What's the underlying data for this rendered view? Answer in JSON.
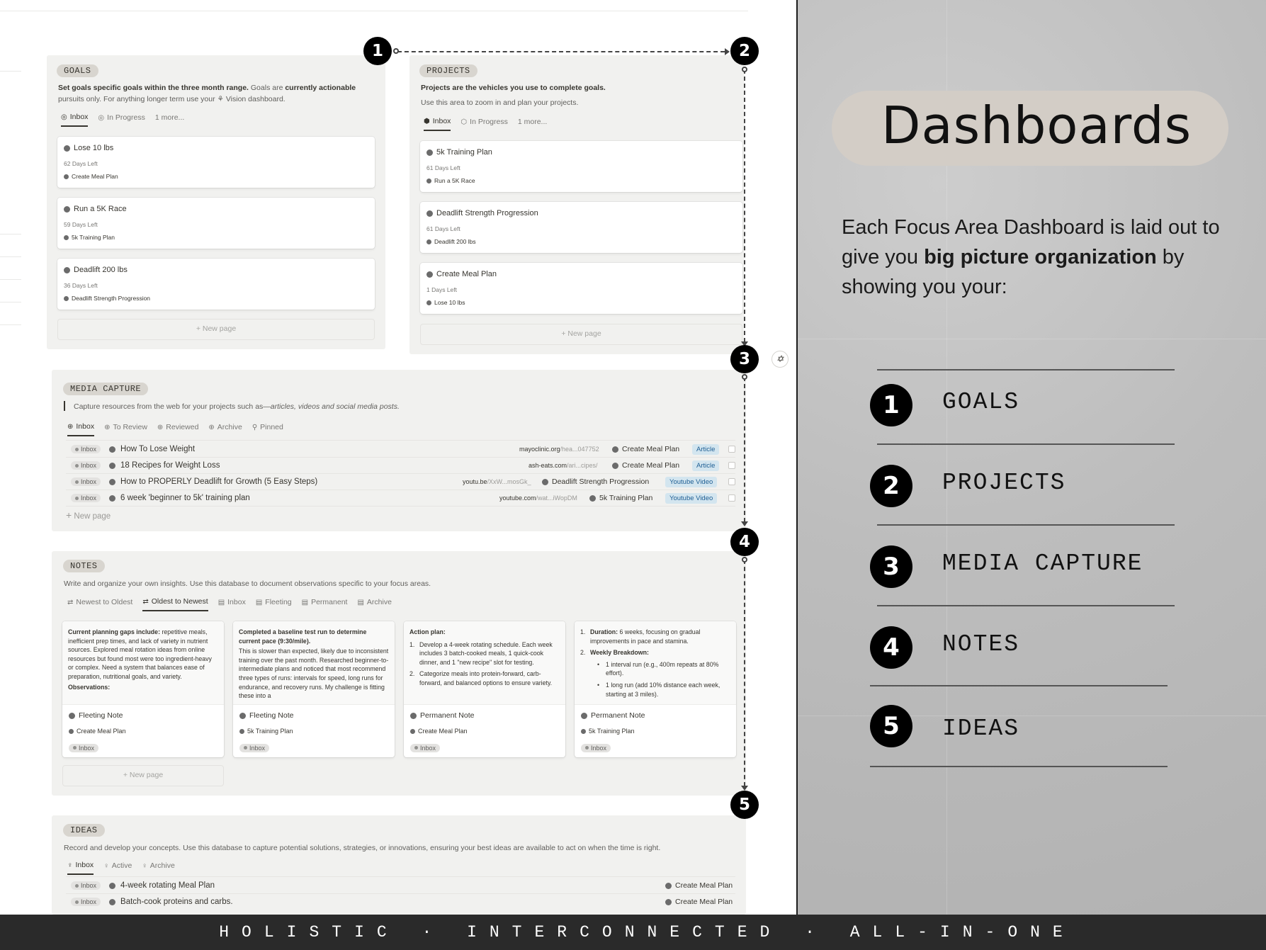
{
  "goals": {
    "tag": "GOALS",
    "desc_bold1": "Set goals specific goals within the three month range.",
    "desc_mid": " Goals are ",
    "desc_bold2": "currently actionable",
    "desc_line2": "pursuits only. For anything longer term use your",
    "desc_link": "Vision",
    "desc_end": " dashboard.",
    "tabs": [
      {
        "label": "Inbox"
      },
      {
        "label": "In Progress"
      },
      {
        "label": "1 more..."
      }
    ],
    "cards": [
      {
        "title": "Lose 10 lbs",
        "days": "62 Days Left",
        "relation": "Create Meal Plan"
      },
      {
        "title": "Run a 5K Race",
        "days": "59 Days Left",
        "relation": "5k Training Plan"
      },
      {
        "title": "Deadlift 200 lbs",
        "days": "36 Days Left",
        "relation": "Deadlift Strength Progression"
      }
    ],
    "new_page": "+ New page"
  },
  "projects": {
    "tag": "PROJECTS",
    "desc_bold": "Projects are the vehicles you use to complete goals.",
    "desc_line2": "Use this area to zoom in and plan your projects.",
    "tabs": [
      {
        "label": "Inbox"
      },
      {
        "label": "In Progress"
      },
      {
        "label": "1 more..."
      }
    ],
    "cards": [
      {
        "title": "5k Training Plan",
        "days": "61 Days Left",
        "relation": "Run a 5K Race"
      },
      {
        "title": "Deadlift Strength Progression",
        "days": "61 Days Left",
        "relation": "Deadlift 200 lbs"
      },
      {
        "title": "Create Meal Plan",
        "days": "1 Days Left",
        "relation": "Lose 10 lbs"
      }
    ],
    "new_page": "+ New page"
  },
  "media": {
    "tag": "MEDIA CAPTURE",
    "desc_start": "Capture resources from the web for your projects such as—",
    "desc_italic": "articles, videos and social media posts.",
    "tabs": [
      {
        "label": "Inbox"
      },
      {
        "label": "To Review"
      },
      {
        "label": "Reviewed"
      },
      {
        "label": "Archive"
      },
      {
        "label": "Pinned"
      }
    ],
    "rows": [
      {
        "status": "Inbox",
        "title": "How To Lose Weight",
        "url_host": "mayoclinic.org",
        "url_path": "/hea...047752",
        "relation": "Create Meal Plan",
        "type": "Article"
      },
      {
        "status": "Inbox",
        "title": "18 Recipes for Weight Loss",
        "url_host": "ash-eats.com",
        "url_path": "/ari...cipes/",
        "relation": "Create Meal Plan",
        "type": "Article"
      },
      {
        "status": "Inbox",
        "title": "How to PROPERLY Deadlift for Growth (5 Easy Steps)",
        "url_host": "youtu.be",
        "url_path": "/XxW...mosGk_",
        "relation": "Deadlift Strength Progression",
        "type": "Youtube Video"
      },
      {
        "status": "Inbox",
        "title": "6 week 'beginner to 5k' training plan",
        "url_host": "youtube.com",
        "url_path": "/wat...iWopDM",
        "relation": "5k Training Plan",
        "type": "Youtube Video"
      }
    ],
    "new_page": "New page"
  },
  "notes": {
    "tag": "NOTES",
    "desc": "Write and organize your own insights. Use this database to document observations specific to your focus areas.",
    "tabs": [
      {
        "label": "Newest to Oldest"
      },
      {
        "label": "Oldest to Newest"
      },
      {
        "label": "Inbox"
      },
      {
        "label": "Fleeting"
      },
      {
        "label": "Permanent"
      },
      {
        "label": "Archive"
      }
    ],
    "cards": [
      {
        "p1_bold": "Current planning gaps include:",
        "p1_text": " repetitive meals, inefficient prep times, and lack of variety in nutrient sources. Explored meal rotation ideas from online resources but found most were too ingredient-heavy or complex. Need a system that balances ease of preparation, nutritional goals, and variety.",
        "p2_bold": "Observations:",
        "type": "Fleeting Note",
        "relation": "Create Meal Plan",
        "status": "Inbox"
      },
      {
        "p1_bold": "Completed a baseline test run to determine current pace (9:30/mile).",
        "p2_text": "This is slower than expected, likely due to inconsistent training over the past month. Researched beginner-to-intermediate plans and noticed that most recommend three types of runs: intervals for speed, long runs for endurance, and recovery runs. My challenge is fitting these into a",
        "type": "Fleeting Note",
        "relation": "5k Training Plan",
        "status": "Inbox"
      },
      {
        "p1_bold": "Action plan:",
        "li1_n": "1.",
        "li1": "Develop a 4-week rotating schedule. Each week includes 3 batch-cooked meals, 1 quick-cook dinner, and 1 \"new recipe\" slot for testing.",
        "li2_n": "2.",
        "li2": "Categorize meals into protein-forward, carb-forward, and balanced options to ensure variety.",
        "type": "Permanent Note",
        "relation": "Create Meal Plan",
        "status": "Inbox"
      },
      {
        "li1_n": "1.",
        "li1_bold": "Duration:",
        "li1": " 6 weeks, focusing on gradual improvements in pace and stamina.",
        "li2_n": "2.",
        "li2_bold": "Weekly Breakdown:",
        "b1": "1 interval run (e.g., 400m repeats at 80% effort).",
        "b2": "1 long run (add 10% distance each week, starting at 3 miles).",
        "type": "Permanent Note",
        "relation": "5k Training Plan",
        "status": "Inbox"
      }
    ],
    "new_page": "+ New page"
  },
  "ideas": {
    "tag": "IDEAS",
    "desc": "Record and develop your concepts. Use this database to capture potential solutions, strategies, or innovations, ensuring your best ideas are available to act on when the time is right.",
    "tabs": [
      {
        "label": "Inbox"
      },
      {
        "label": "Active"
      },
      {
        "label": "Archive"
      }
    ],
    "rows": [
      {
        "status": "Inbox",
        "title": "4-week rotating Meal Plan",
        "relation": "Create Meal Plan"
      },
      {
        "status": "Inbox",
        "title": "Batch-cook proteins and carbs.",
        "relation": "Create Meal Plan"
      }
    ]
  },
  "markers": [
    "1",
    "2",
    "3",
    "4",
    "5"
  ],
  "ai_button": "✡",
  "right": {
    "title": "Dashboards",
    "intro_1": "Each Focus Area Dashboard is laid out to give you ",
    "intro_bold": "big picture organization",
    "intro_2": " by showing you your:",
    "items": [
      {
        "num": "1",
        "label": "GOALS"
      },
      {
        "num": "2",
        "label": "PROJECTS"
      },
      {
        "num": "3",
        "label": "MEDIA CAPTURE"
      },
      {
        "num": "4",
        "label": "NOTES"
      },
      {
        "num": "5",
        "label": "IDEAS"
      }
    ]
  },
  "footer": "HOLISTIC · INTERCONNECTED · ALL-IN-ONE",
  "colors": {
    "accent_black": "#000000",
    "panel_bg": "#f1f1ef",
    "tag_bg": "#d8d5cf",
    "type_tag_bg": "#d3e5ef",
    "type_tag_text": "#1f5f94",
    "footer_bg": "#2a2a2a"
  }
}
